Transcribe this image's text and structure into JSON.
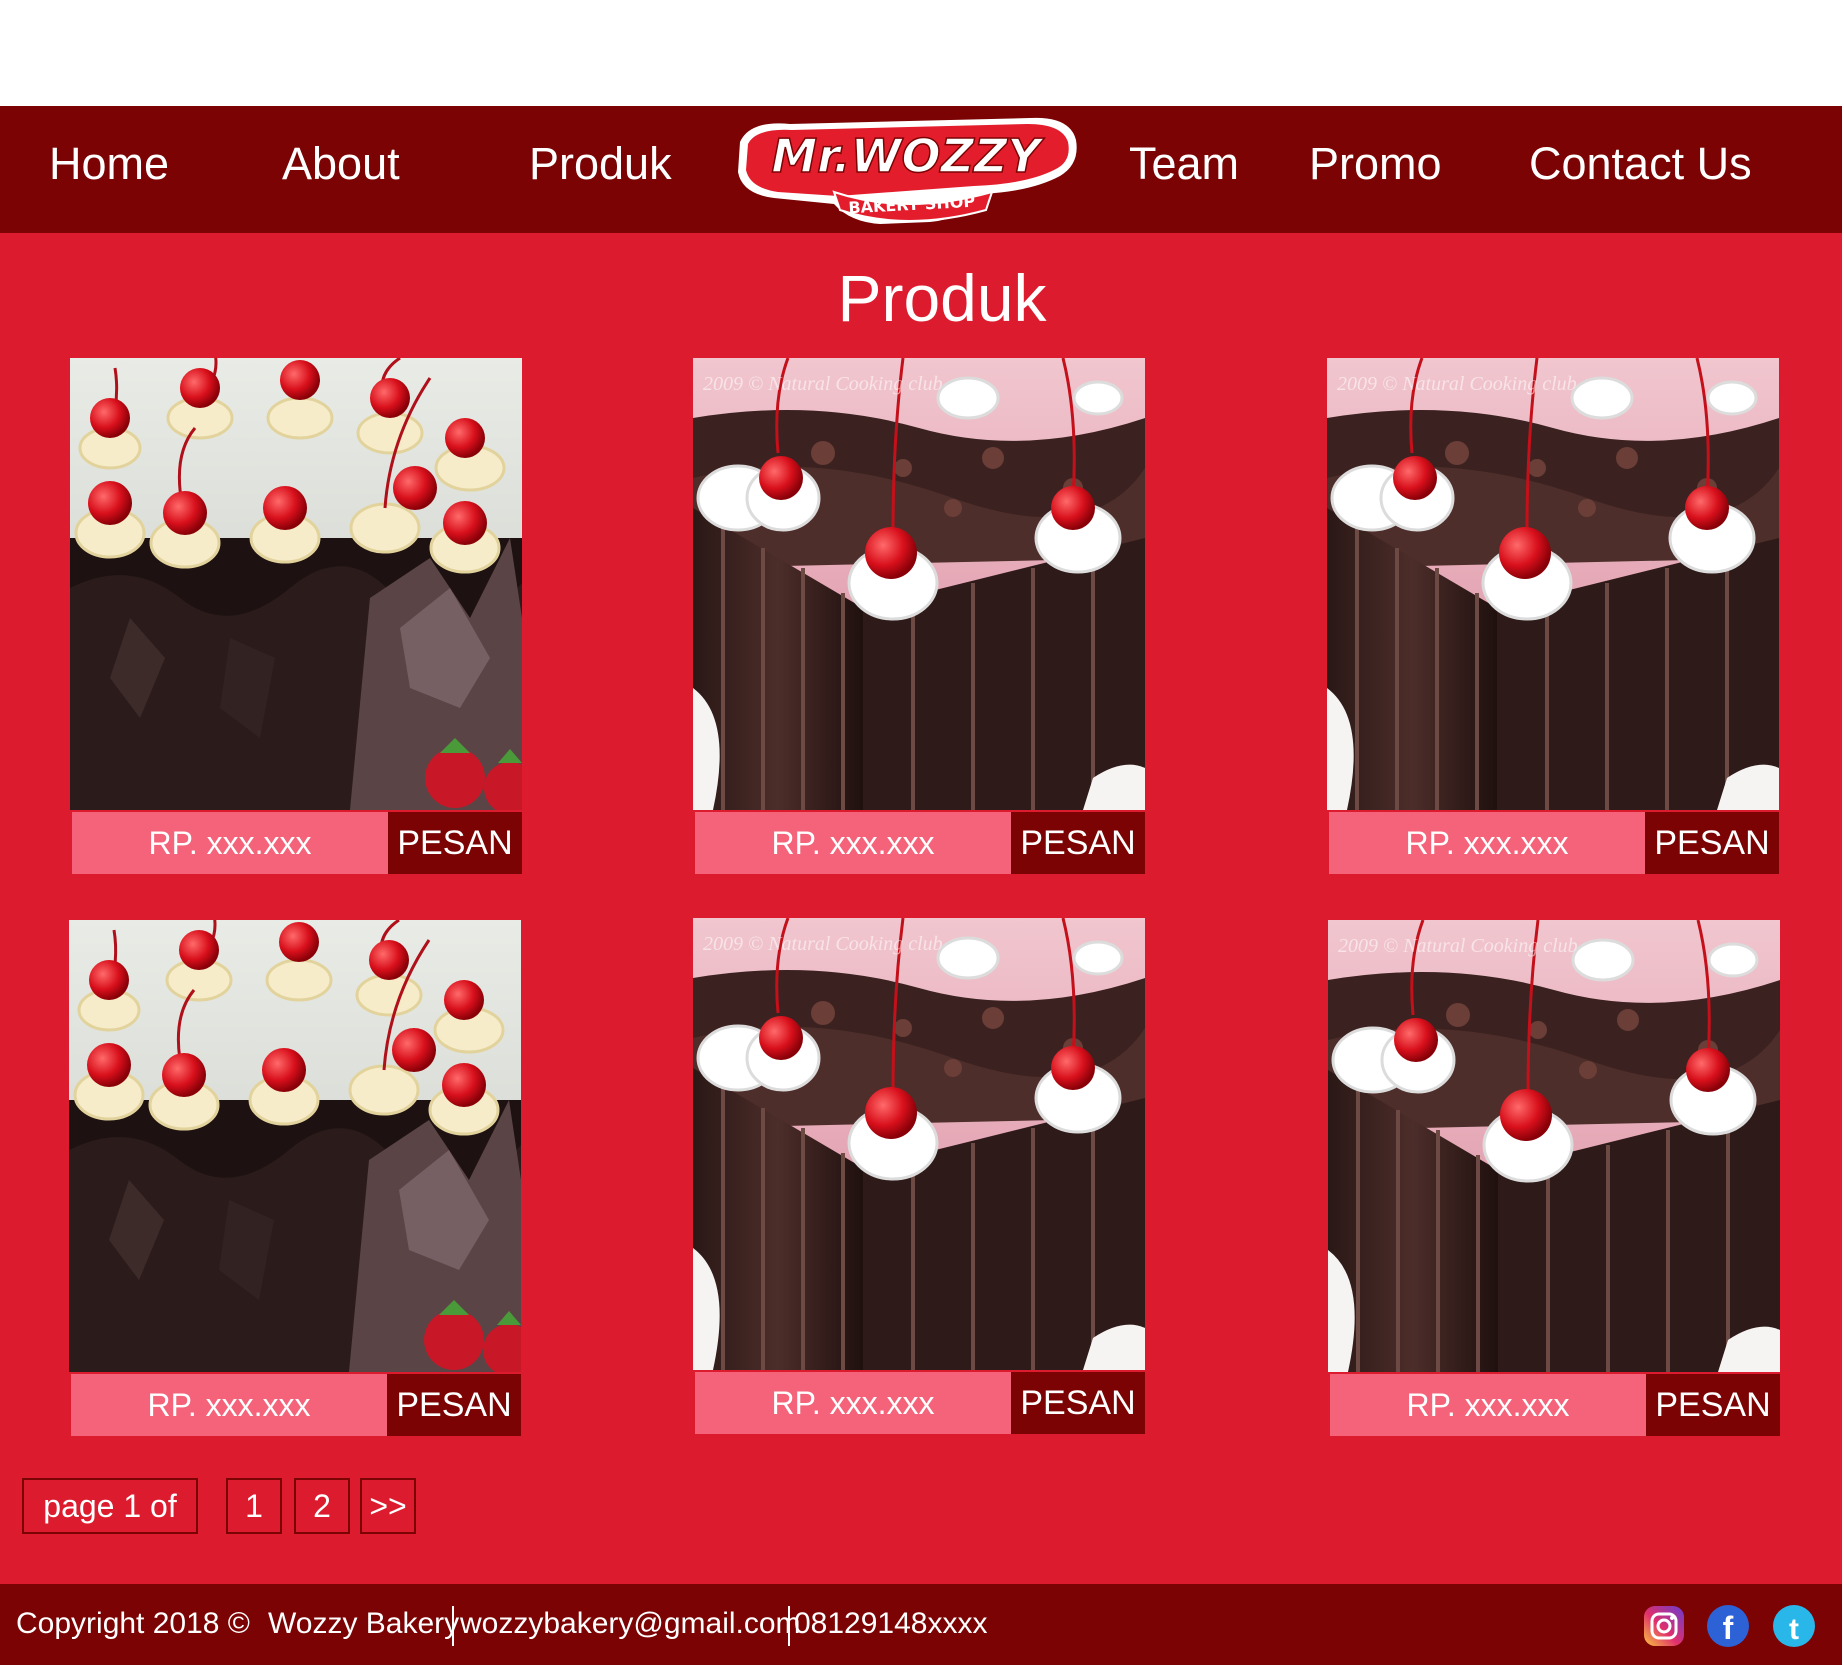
{
  "nav": {
    "items": [
      {
        "label": "Home"
      },
      {
        "label": "About"
      },
      {
        "label": "Produk"
      },
      {
        "label": "Team"
      },
      {
        "label": "Promo"
      },
      {
        "label": "Contact Us"
      }
    ],
    "logo": {
      "title": "Mr.WOZZY",
      "subtitle": "BAKERY SHOP"
    }
  },
  "page": {
    "title": "Produk"
  },
  "products": [
    {
      "image": "cherry-cream-cake-photo",
      "price": "RP. xxx.xxx",
      "order_label": "PESAN"
    },
    {
      "image": "black-forest-cake-photo",
      "price": "RP. xxx.xxx",
      "order_label": "PESAN"
    },
    {
      "image": "black-forest-cake-photo",
      "price": "RP. xxx.xxx",
      "order_label": "PESAN"
    },
    {
      "image": "cherry-cream-cake-photo",
      "price": "RP. xxx.xxx",
      "order_label": "PESAN"
    },
    {
      "image": "black-forest-cake-photo",
      "price": "RP. xxx.xxx",
      "order_label": "PESAN"
    },
    {
      "image": "black-forest-cake-photo",
      "price": "RP. xxx.xxx",
      "order_label": "PESAN"
    }
  ],
  "pagination": {
    "label": "page 1 of",
    "pages": [
      "1",
      "2"
    ],
    "next": ">>"
  },
  "footer": {
    "copyright": "Copyright 2018 ©",
    "company": "Wozzy Bakery",
    "email": "wozzybakery@gmail.com",
    "phone": "08129148xxxx",
    "social": [
      "instagram-icon",
      "facebook-icon",
      "twitter-icon"
    ]
  },
  "colors": {
    "background": "#dc1c2e",
    "nav": "#7b0303",
    "price": "#f4637a",
    "order": "#7b0303"
  }
}
